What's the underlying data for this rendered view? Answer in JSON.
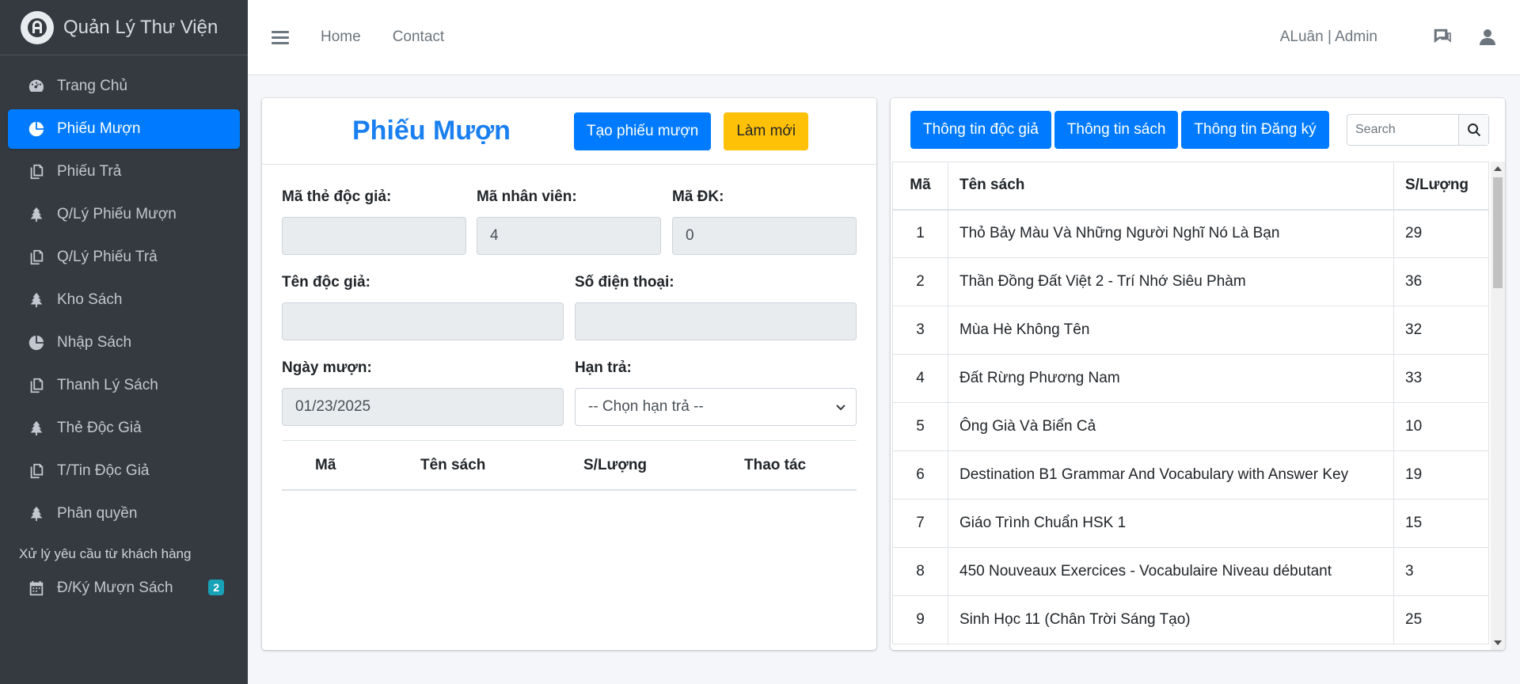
{
  "brand": {
    "title": "Quản Lý Thư Viện"
  },
  "sidebar": {
    "items": [
      {
        "label": "Trang Chủ",
        "icon": "dashboard-icon"
      },
      {
        "label": "Phiếu Mượn",
        "icon": "pie-chart-icon",
        "active": true
      },
      {
        "label": "Phiếu Trả",
        "icon": "copy-icon"
      },
      {
        "label": "Q/Lý Phiếu Mượn",
        "icon": "tree-icon"
      },
      {
        "label": "Q/Lý Phiếu Trả",
        "icon": "copy-icon"
      },
      {
        "label": "Kho Sách",
        "icon": "tree-icon"
      },
      {
        "label": "Nhập Sách",
        "icon": "pie-chart-icon"
      },
      {
        "label": "Thanh Lý Sách",
        "icon": "copy-icon"
      },
      {
        "label": "Thẻ Độc Giả",
        "icon": "tree-icon"
      },
      {
        "label": "T/Tin Độc Giả",
        "icon": "copy-icon"
      },
      {
        "label": "Phân quyền",
        "icon": "tree-icon"
      }
    ],
    "section_header": "Xử lý yêu cầu từ khách hàng",
    "request_item": {
      "label": "Đ/Ký Mượn Sách",
      "icon": "calendar-icon",
      "badge": "2"
    }
  },
  "topbar": {
    "links": [
      "Home",
      "Contact"
    ],
    "user": "ALuân | Admin"
  },
  "borrow_form": {
    "title": "Phiếu Mượn",
    "create_button": "Tạo phiếu mượn",
    "refresh_button": "Làm mới",
    "fields": {
      "reader_card_label": "Mã thẻ độc giả:",
      "reader_card_value": "",
      "employee_label": "Mã nhân viên:",
      "employee_value": "4",
      "reg_label": "Mã ĐK:",
      "reg_value": "0",
      "reader_name_label": "Tên độc giả:",
      "reader_name_value": "",
      "phone_label": "Số điện thoại:",
      "phone_value": "",
      "borrow_date_label": "Ngày mượn:",
      "borrow_date_value": "01/23/2025",
      "due_label": "Hạn trả:",
      "due_selected": "-- Chọn hạn trả --"
    },
    "table_headers": [
      "Mã",
      "Tên sách",
      "S/Lượng",
      "Thao tác"
    ]
  },
  "book_panel": {
    "tabs": [
      "Thông tin độc giả",
      "Thông tin sách",
      "Thông tin Đăng ký"
    ],
    "search_placeholder": "Search",
    "headers": [
      "Mã",
      "Tên sách",
      "S/Lượng"
    ],
    "rows": [
      [
        "1",
        "Thỏ Bảy Màu Và Những Người Nghĩ Nó Là Bạn",
        "29"
      ],
      [
        "2",
        "Thần Đồng Đất Việt 2 - Trí Nhớ Siêu Phàm",
        "36"
      ],
      [
        "3",
        "Mùa Hè Không Tên",
        "32"
      ],
      [
        "4",
        "Đất Rừng Phương Nam",
        "33"
      ],
      [
        "5",
        "Ông Già Và Biển Cả",
        "10"
      ],
      [
        "6",
        "Destination B1 Grammar And Vocabulary with Answer Key",
        "19"
      ],
      [
        "7",
        "Giáo Trình Chuẩn HSK 1",
        "15"
      ],
      [
        "8",
        "450 Nouveaux Exercices - Vocabulaire Niveau débutant",
        "3"
      ],
      [
        "9",
        "Sinh Học 11 (Chân Trời Sáng Tạo)",
        "25"
      ]
    ]
  },
  "colors": {
    "primary": "#007bff",
    "warning": "#ffc107",
    "sidebar": "#343a40",
    "info": "#17a2b8"
  }
}
